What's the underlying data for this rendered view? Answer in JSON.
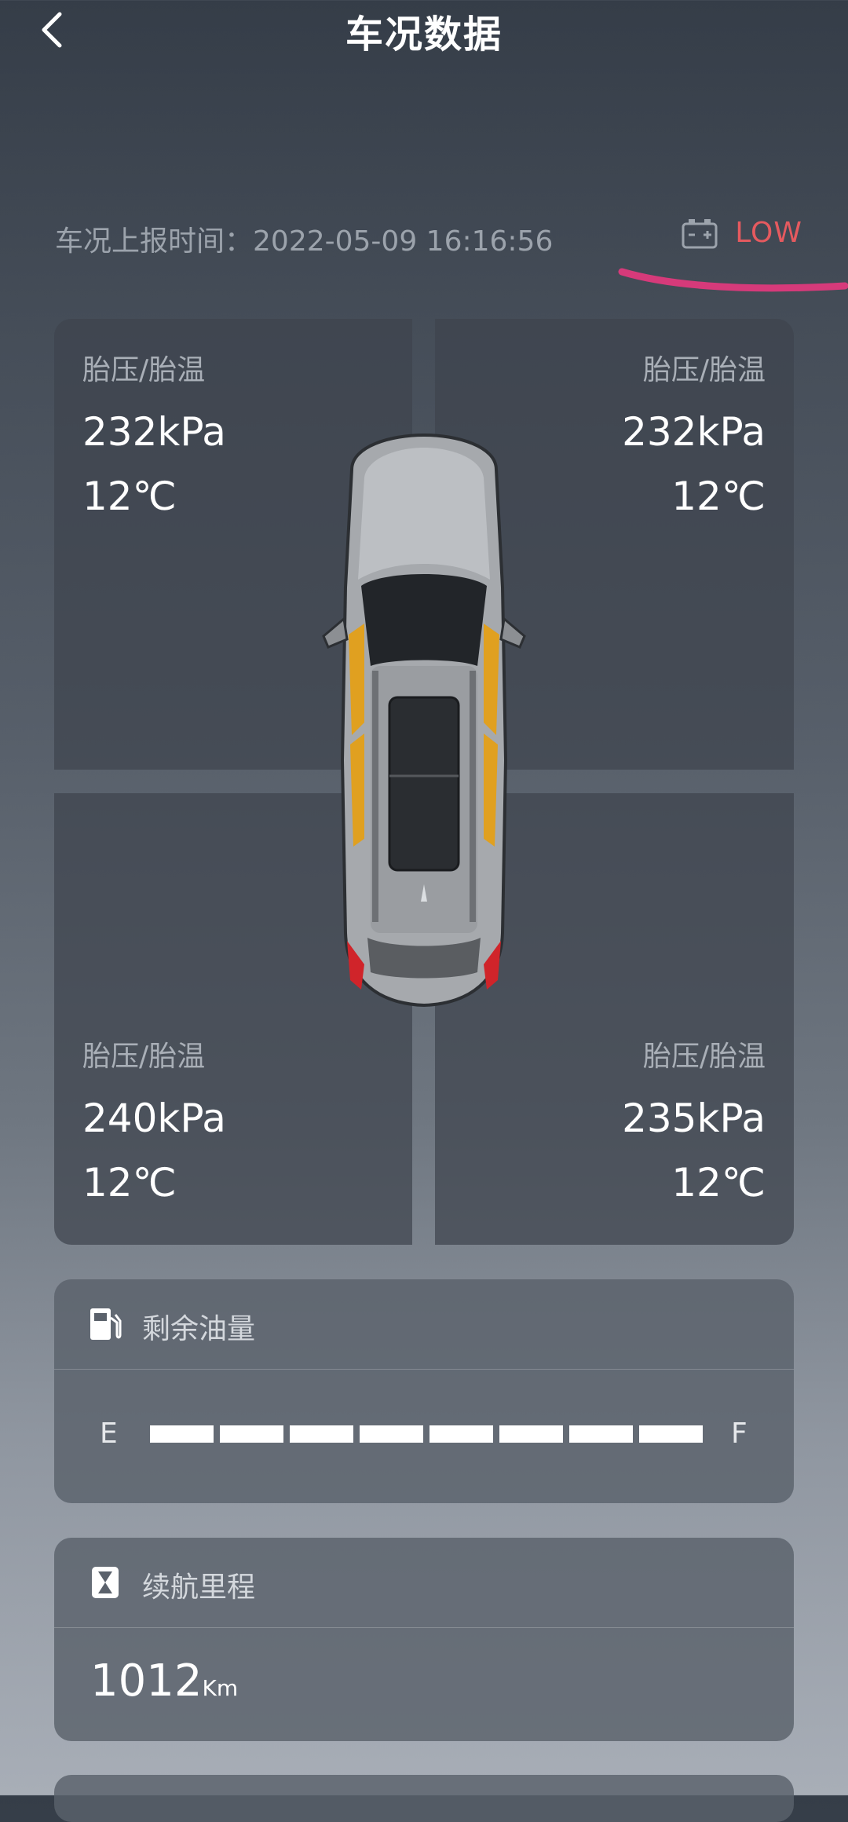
{
  "header": {
    "title": "车况数据"
  },
  "report": {
    "label": "车况上报时间：",
    "time": "2022-05-09 16:16:56"
  },
  "battery": {
    "status": "LOW",
    "icon": "battery-icon",
    "status_color": "#e55a5f"
  },
  "tires": {
    "front_left": {
      "label": "胎压/胎温",
      "pressure": "232kPa",
      "temperature": "12℃"
    },
    "front_right": {
      "label": "胎压/胎温",
      "pressure": "232kPa",
      "temperature": "12℃"
    },
    "rear_left": {
      "label": "胎压/胎温",
      "pressure": "240kPa",
      "temperature": "12℃"
    },
    "rear_right": {
      "label": "胎压/胎温",
      "pressure": "235kPa",
      "temperature": "12℃"
    }
  },
  "fuel": {
    "title": "剩余油量",
    "icon": "fuel-pump-icon",
    "empty_label": "E",
    "full_label": "F",
    "filled_segments": 8,
    "total_segments": 8
  },
  "range": {
    "title": "续航里程",
    "icon": "hourglass-icon",
    "value": "1012",
    "unit": "Km"
  },
  "colors": {
    "annotation_stroke": "#d63a7a",
    "car_highlight": "#e0a020"
  }
}
